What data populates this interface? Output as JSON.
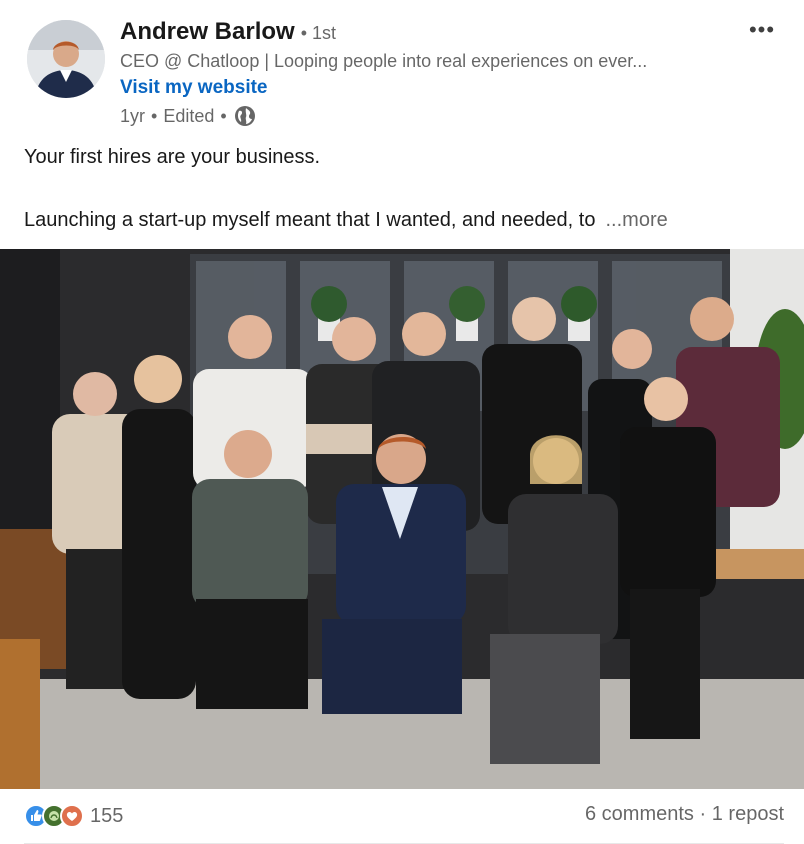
{
  "author": {
    "name": "Andrew Barlow",
    "degree": "• 1st",
    "headline": "CEO @ Chatloop | Looping people into real experiences on ever...",
    "website_label": "Visit my website",
    "time": "1yr",
    "edited": "Edited",
    "separator": "•",
    "visibility_icon": "globe-icon"
  },
  "menu_icon": "more-horizontal-icon",
  "post": {
    "line1": "Your first hires are your business.",
    "line2": "Launching a start-up myself meant that I wanted, and needed, to",
    "see_more": "...more"
  },
  "social": {
    "reaction_icons": [
      "like-icon",
      "celebrate-icon",
      "love-icon"
    ],
    "reaction_count": "155",
    "comments": "6 comments",
    "separator": "·",
    "reposts": "1 repost"
  },
  "colors": {
    "link_blue": "#0a66c2",
    "like": "#378fe9",
    "celebrate": "#44712e",
    "love": "#df704d"
  }
}
